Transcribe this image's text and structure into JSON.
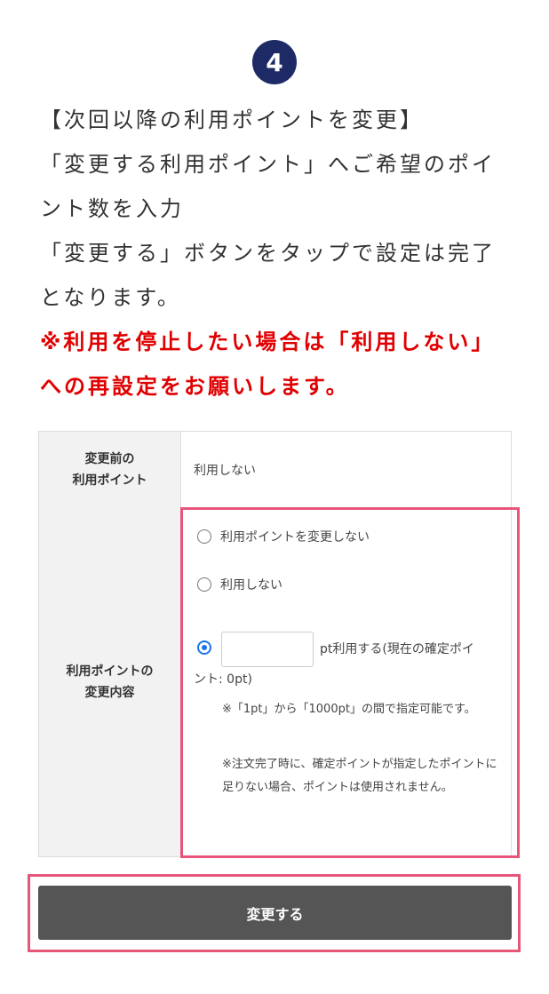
{
  "step": {
    "number": "4"
  },
  "instructions": {
    "lines": [
      "【次回以降の利用ポイントを変更】",
      "「変更する利用ポイント」へご希望のポイ",
      "ント数を入力",
      "「変更する」ボタンをタップで設定は完了",
      "となります。"
    ],
    "warning_lines": [
      "※利用を停止したい場合は「利用しない」",
      "への再設定をお願いします。"
    ]
  },
  "table": {
    "before": {
      "header": [
        "変更前の",
        "利用ポイント"
      ],
      "value": "利用しない"
    },
    "change": {
      "header": [
        "利用ポイントの",
        "変更内容"
      ],
      "options": [
        {
          "label": "利用ポイントを変更しない",
          "checked": false
        },
        {
          "label": "利用しない",
          "checked": false
        },
        {
          "label": "",
          "checked": true
        }
      ],
      "points_input": {
        "value": "",
        "placeholder": ""
      },
      "points_suffix_1": "pt利用する(現在の確定ポイ",
      "points_suffix_2": "ント: 0pt)",
      "note_1": "※「1pt」から「1000pt」の間で指定可能です。",
      "note_2": "※注文完了時に、確定ポイントが指定したポイントに足りない場合、ポイントは使用されません。"
    }
  },
  "submit": {
    "label": "変更する"
  },
  "colors": {
    "badge": "#1d2a66",
    "warning": "#e00000",
    "highlight": "#e8557a",
    "radio_checked": "#1a73e8",
    "button": "#555555"
  }
}
